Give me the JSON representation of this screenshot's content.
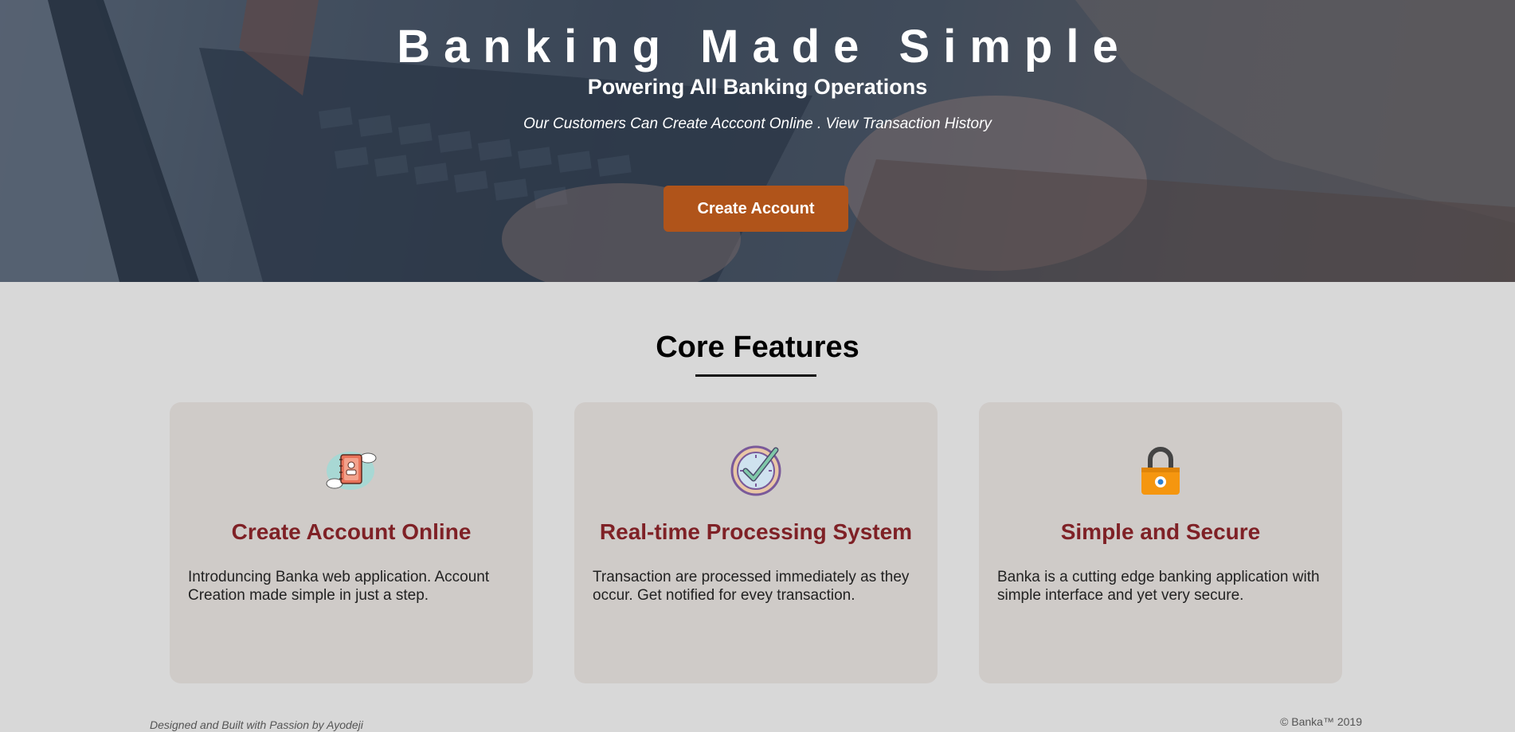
{
  "hero": {
    "title": "Banking Made Simple",
    "subtitle": "Powering All Banking Operations",
    "tagline": "Our Customers Can Create Acccont Online . View Transaction History",
    "cta_label": "Create Account"
  },
  "features": {
    "heading": "Core Features",
    "cards": [
      {
        "icon": "address-book-icon",
        "title": "Create Account Online",
        "text": "Introduncing Banka web application. Account Creation made simple in just a step."
      },
      {
        "icon": "clock-check-icon",
        "title": "Real-time Processing System",
        "text": "Transaction are processed immediately as they occur. Get notified for evey transaction."
      },
      {
        "icon": "padlock-icon",
        "title": "Simple and Secure",
        "text": "Banka is a cutting edge banking application with simple interface and yet very secure."
      }
    ]
  },
  "footer": {
    "credit": "Designed and Built with Passion by Ayodeji",
    "copyright": "© Banka™ 2019"
  },
  "colors": {
    "accent": "#b0541a",
    "card_title": "#7f2126",
    "page_bg": "#d8d8d8",
    "card_bg": "#cfcbc8"
  }
}
